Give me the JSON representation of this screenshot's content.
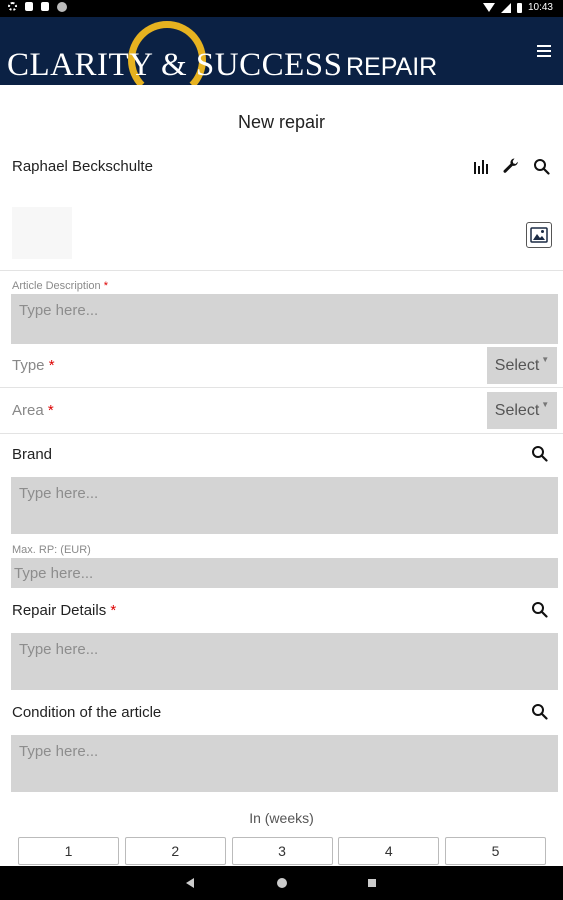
{
  "status_bar": {
    "time": "10:43"
  },
  "header": {
    "logo_text": "CLARITY & SUCCESS",
    "logo_sub": "REPAIR",
    "accent_color": "#e6b220",
    "background_color": "#0b2144"
  },
  "page": {
    "title": "New repair",
    "user_name": "Raphael Beckschulte"
  },
  "form": {
    "article_description": {
      "label": "Article Description",
      "required": "*",
      "placeholder": "Type here..."
    },
    "type": {
      "label": "Type",
      "required": "*",
      "select_label": "Select"
    },
    "area": {
      "label": "Area",
      "required": "*",
      "select_label": "Select"
    },
    "brand": {
      "label": "Brand",
      "placeholder": "Type here..."
    },
    "max_rp": {
      "label": "Max. RP: (EUR)",
      "placeholder": "Type here..."
    },
    "repair_details": {
      "label": "Repair Details",
      "required": "*",
      "placeholder": "Type here..."
    },
    "condition": {
      "label": "Condition of the article",
      "placeholder": "Type here..."
    },
    "weeks": {
      "label": "In (weeks)",
      "options": [
        "1",
        "2",
        "3",
        "4",
        "5"
      ]
    }
  },
  "icons": {
    "top": [
      "bar-chart-icon",
      "wrench-icon",
      "search-icon"
    ],
    "photo": "image-icon",
    "menu": "hamburger-menu-icon"
  }
}
